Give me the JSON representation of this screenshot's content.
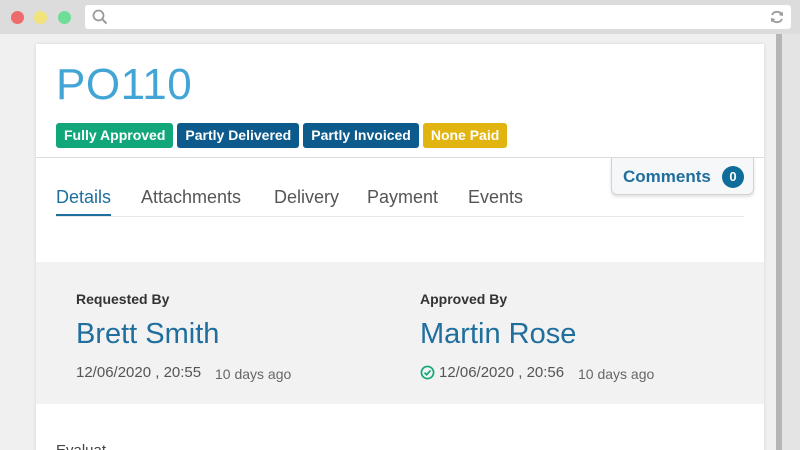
{
  "po": {
    "number": "PO110"
  },
  "badges": [
    {
      "label": "Fully Approved",
      "color": "#12a77a"
    },
    {
      "label": "Partly Delivered",
      "color": "#0d5b8c"
    },
    {
      "label": "Partly Invoiced",
      "color": "#0d5b8c"
    },
    {
      "label": "None Paid",
      "color": "#e2b410"
    }
  ],
  "comments": {
    "label": "Comments",
    "count": "0"
  },
  "tabs": [
    {
      "label": "Details",
      "active": true
    },
    {
      "label": "Attachments"
    },
    {
      "label": "Delivery"
    },
    {
      "label": "Payment"
    },
    {
      "label": "Events"
    }
  ],
  "requested": {
    "label": "Requested By",
    "name": "Brett Smith",
    "date": "12/06/2020 , 20:55",
    "ago": "10 days ago"
  },
  "approved": {
    "label": "Approved By",
    "name": "Martin Rose",
    "date": "12/06/2020 , 20:56",
    "ago": "10 days ago"
  },
  "next_section": {
    "label": "Evaluat"
  },
  "colors": {
    "accent": "#1f6e9e",
    "title": "#42a5d6",
    "approved_check": "#12a77a"
  }
}
